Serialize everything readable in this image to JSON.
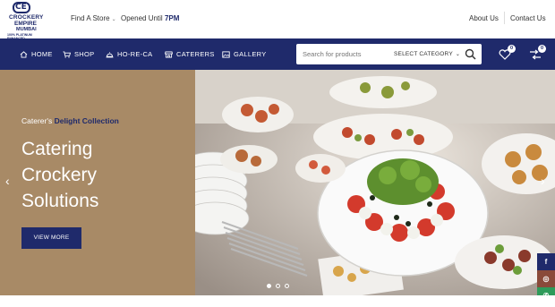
{
  "brand": {
    "logo_mark": "CE",
    "line1": "CROCKERY",
    "line2": "EMPIRE",
    "line3": "MUMBAI",
    "tagline": "100% PLATINUM ENHANCED",
    "color": "#1f2a6b"
  },
  "topbar": {
    "find_store": "Find A Store",
    "opened_prefix": "Opened Until",
    "opened_time": "7PM",
    "about": "About Us",
    "contact": "Contact Us"
  },
  "nav": {
    "items": [
      {
        "label": "HOME",
        "icon": "home-icon"
      },
      {
        "label": "SHOP",
        "icon": "cart-icon"
      },
      {
        "label": "HO-RE-CA",
        "icon": "cloche-icon"
      },
      {
        "label": "CATERERS",
        "icon": "shop-icon"
      },
      {
        "label": "GALLERY",
        "icon": "gallery-icon"
      }
    ],
    "background": "#1f2a6b"
  },
  "search": {
    "placeholder": "Search for products",
    "category": "SELECT CATEGORY"
  },
  "header_icons": {
    "wishlist_count": "0",
    "compare_count": "0"
  },
  "hero": {
    "subtitle_prefix": "Caterer's",
    "subtitle_highlight": "Delight Collection",
    "title_lines": [
      "Catering",
      "Crockery",
      "Solutions"
    ],
    "cta": "VIEW MORE",
    "slide_count": 3,
    "active_slide": 1,
    "panel_color": "#a88a66"
  },
  "social": [
    {
      "icon": "facebook-icon",
      "glyph": "f",
      "color": "#1f2a6b"
    },
    {
      "icon": "instagram-icon",
      "glyph": "◎",
      "color": "#8a4a3a"
    },
    {
      "icon": "whatsapp-icon",
      "glyph": "✆",
      "color": "#2e9b5a"
    }
  ]
}
